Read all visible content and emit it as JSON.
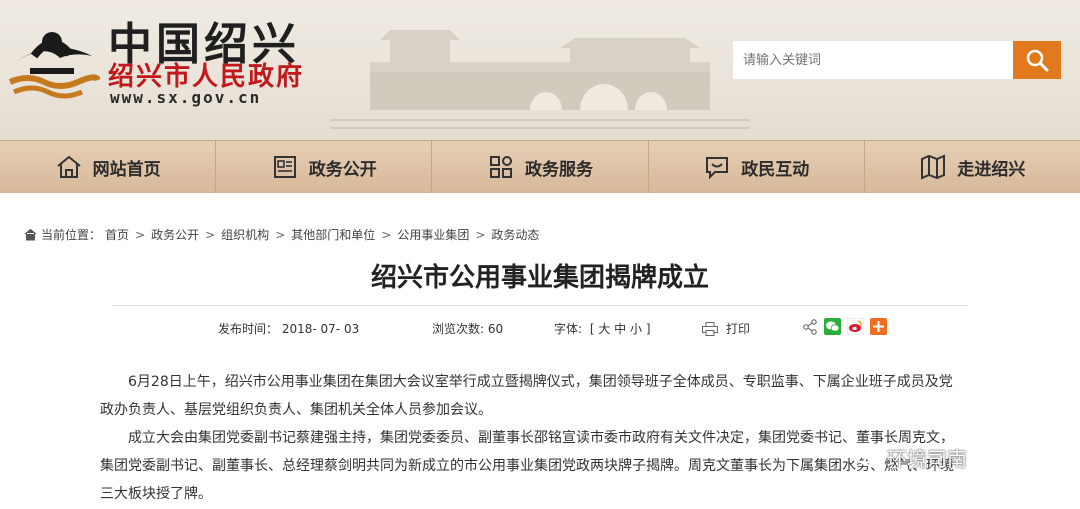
{
  "header": {
    "logo_title": "中国绍兴",
    "logo_subtitle": "绍兴市人民政府",
    "logo_url": "www.sx.gov.cn",
    "search_placeholder": "请输入关键词"
  },
  "nav": [
    {
      "label": "网站首页",
      "icon": "home-icon"
    },
    {
      "label": "政务公开",
      "icon": "document-icon"
    },
    {
      "label": "政务服务",
      "icon": "grid-icon"
    },
    {
      "label": "政民互动",
      "icon": "chat-icon"
    },
    {
      "label": "走进绍兴",
      "icon": "map-icon"
    }
  ],
  "breadcrumb": {
    "prefix": "当前位置：",
    "items": [
      "首页",
      "政务公开",
      "组织机构",
      "其他部门和单位",
      "公用事业集团",
      "政务动态"
    ]
  },
  "article": {
    "title": "绍兴市公用事业集团揭牌成立",
    "publish_label": "发布时间：",
    "publish_date": "2018- 07- 03",
    "views_label": "浏览次数:",
    "views": "60",
    "font_label": "字体:",
    "font_options": "[ 大 中 小 ]",
    "print_label": "打印",
    "paragraph1": "6月28日上午，绍兴市公用事业集团在集团大会议室举行成立暨揭牌仪式，集团领导班子全体成员、专职监事、下属企业班子成员及党政办负责人、基层党组织负责人、集团机关全体人员参加会议。",
    "paragraph2": "成立大会由集团党委副书记蔡建强主持，集团党委委员、副董事长邵铭宣读市委市政府有关文件决定，集团党委书记、董事长周克文，集团党委副书记、副董事长、总经理蔡剑明共同为新成立的市公用事业集团党政两块牌子揭牌。周克文董事长为下属集团水务、燃气、环境三大板块授了牌。"
  },
  "watermark": "环境司南",
  "colors": {
    "accent": "#e07a1c",
    "logo_red": "#c0181b",
    "nav_bg": "#dcc0a2"
  }
}
